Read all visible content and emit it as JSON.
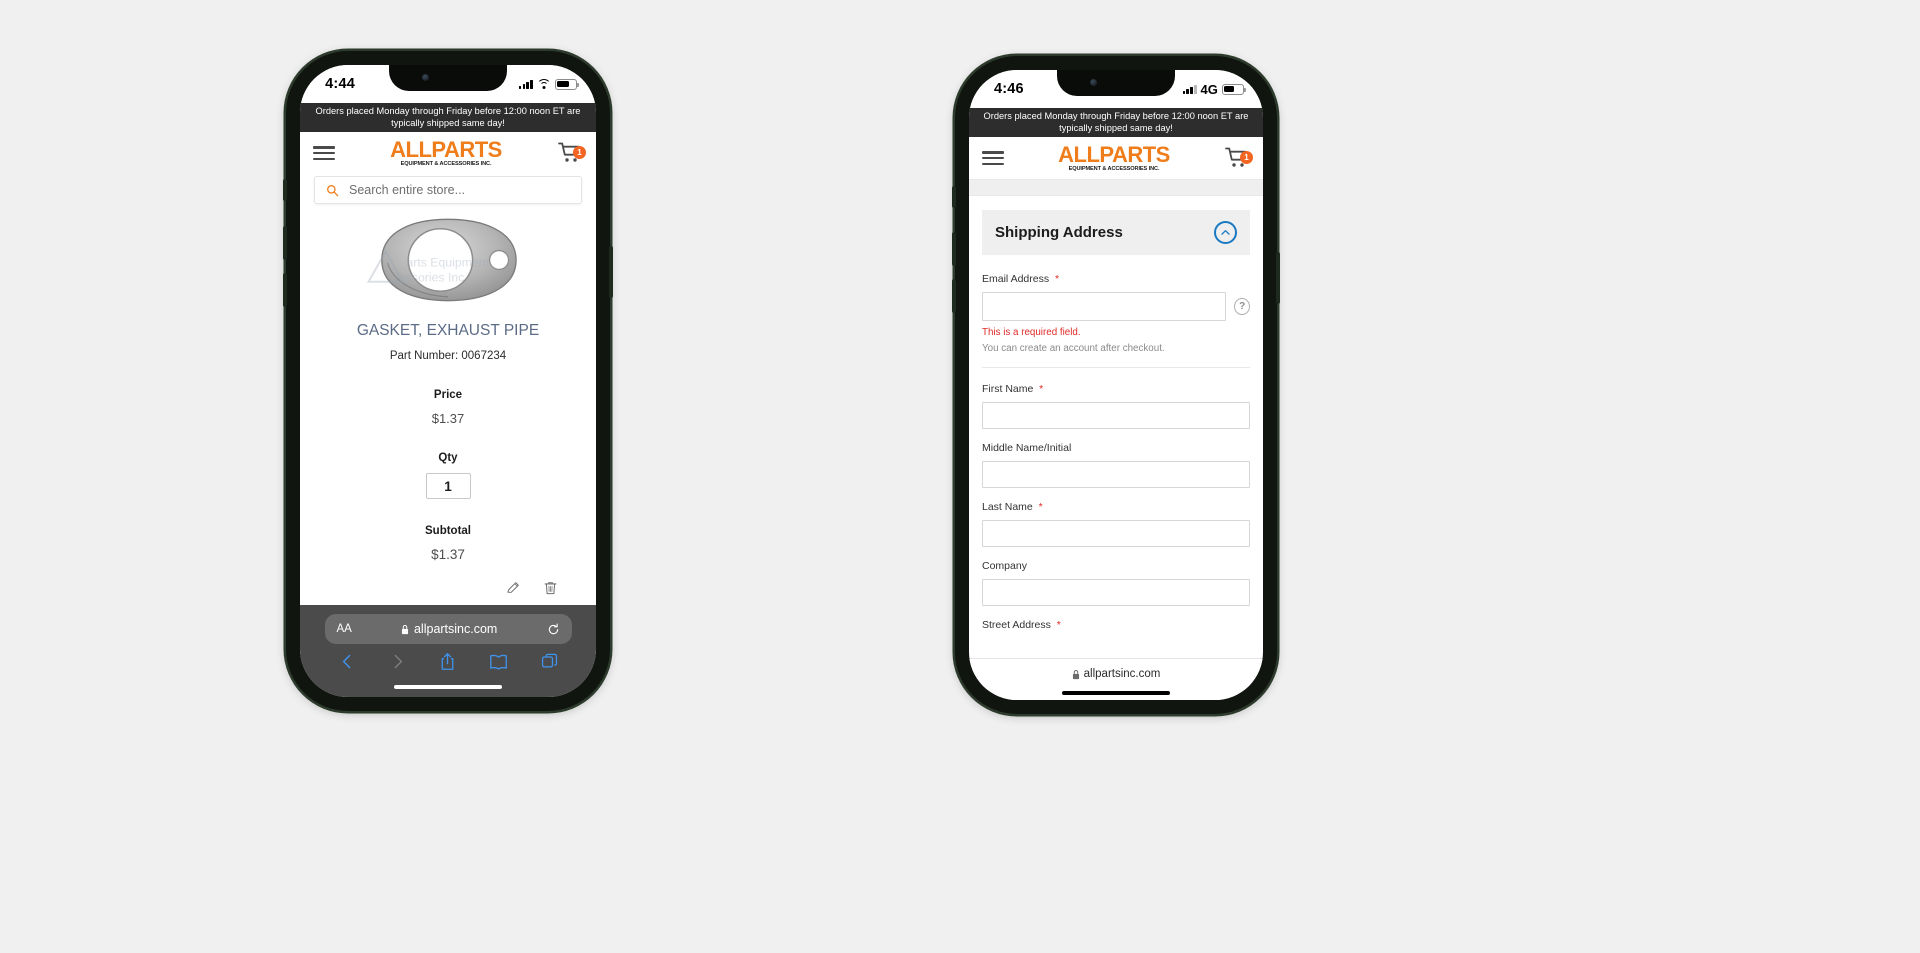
{
  "scene": {
    "background": "#f0f0f0",
    "accent_orange": "#f26522",
    "link_blue": "#1979c3"
  },
  "phone_left": {
    "status": {
      "time": "4:44",
      "network": "",
      "battery_percent": 62
    },
    "promo_banner": "Orders placed Monday through Friday before 12:00 noon ET are typically shipped same day!",
    "header": {
      "menu_icon": "hamburger-icon",
      "logo_main": "ALLPARTS",
      "logo_sub": "EQUIPMENT & ACCESSORIES INC.",
      "cart_icon": "shopping-cart-icon",
      "cart_count": "1"
    },
    "search": {
      "icon": "search-icon",
      "placeholder": "Search entire store...",
      "value": ""
    },
    "product": {
      "image_alt": "exhaust pipe gasket",
      "watermark": "All Parts Equipment & Accessories Inc.",
      "title": "GASKET, EXHAUST PIPE",
      "part_number": "Part Number: 0067234",
      "price_label": "Price",
      "price_value": "$1.37",
      "qty_label": "Qty",
      "qty_value": "1",
      "subtotal_label": "Subtotal",
      "subtotal_value": "$1.37",
      "edit_icon": "pencil-icon",
      "delete_icon": "trash-icon"
    },
    "safari": {
      "text_size_button": "AA",
      "lock_icon": "lock-icon",
      "url": "allpartsinc.com",
      "reload_icon": "reload-icon",
      "back_icon": "chevron-left-icon",
      "forward_icon": "chevron-right-icon",
      "share_icon": "share-icon",
      "bookmarks_icon": "book-icon",
      "tabs_icon": "tabs-icon"
    }
  },
  "phone_right": {
    "status": {
      "time": "4:46",
      "network": "4G",
      "battery_percent": 55
    },
    "promo_banner": "Orders placed Monday through Friday before 12:00 noon ET are typically shipped same day!",
    "header": {
      "menu_icon": "hamburger-icon",
      "logo_main": "ALLPARTS",
      "logo_sub": "EQUIPMENT & ACCESSORIES INC.",
      "cart_icon": "shopping-cart-icon",
      "cart_count": "1"
    },
    "checkout": {
      "section_title": "Shipping Address",
      "collapse_icon": "chevron-up-circle-icon",
      "fields": [
        {
          "label": "Email Address",
          "required": true,
          "value": "",
          "error": "This is a required field.",
          "hint": "You can create an account after checkout.",
          "help_icon": "question-mark-icon"
        },
        {
          "label": "First Name",
          "required": true,
          "value": ""
        },
        {
          "label": "Middle Name/Initial",
          "required": false,
          "value": ""
        },
        {
          "label": "Last Name",
          "required": true,
          "value": ""
        },
        {
          "label": "Company",
          "required": false,
          "value": ""
        },
        {
          "label": "Street Address",
          "required": true,
          "value": ""
        }
      ]
    },
    "safari": {
      "lock_icon": "lock-icon",
      "url": "allpartsinc.com"
    }
  }
}
